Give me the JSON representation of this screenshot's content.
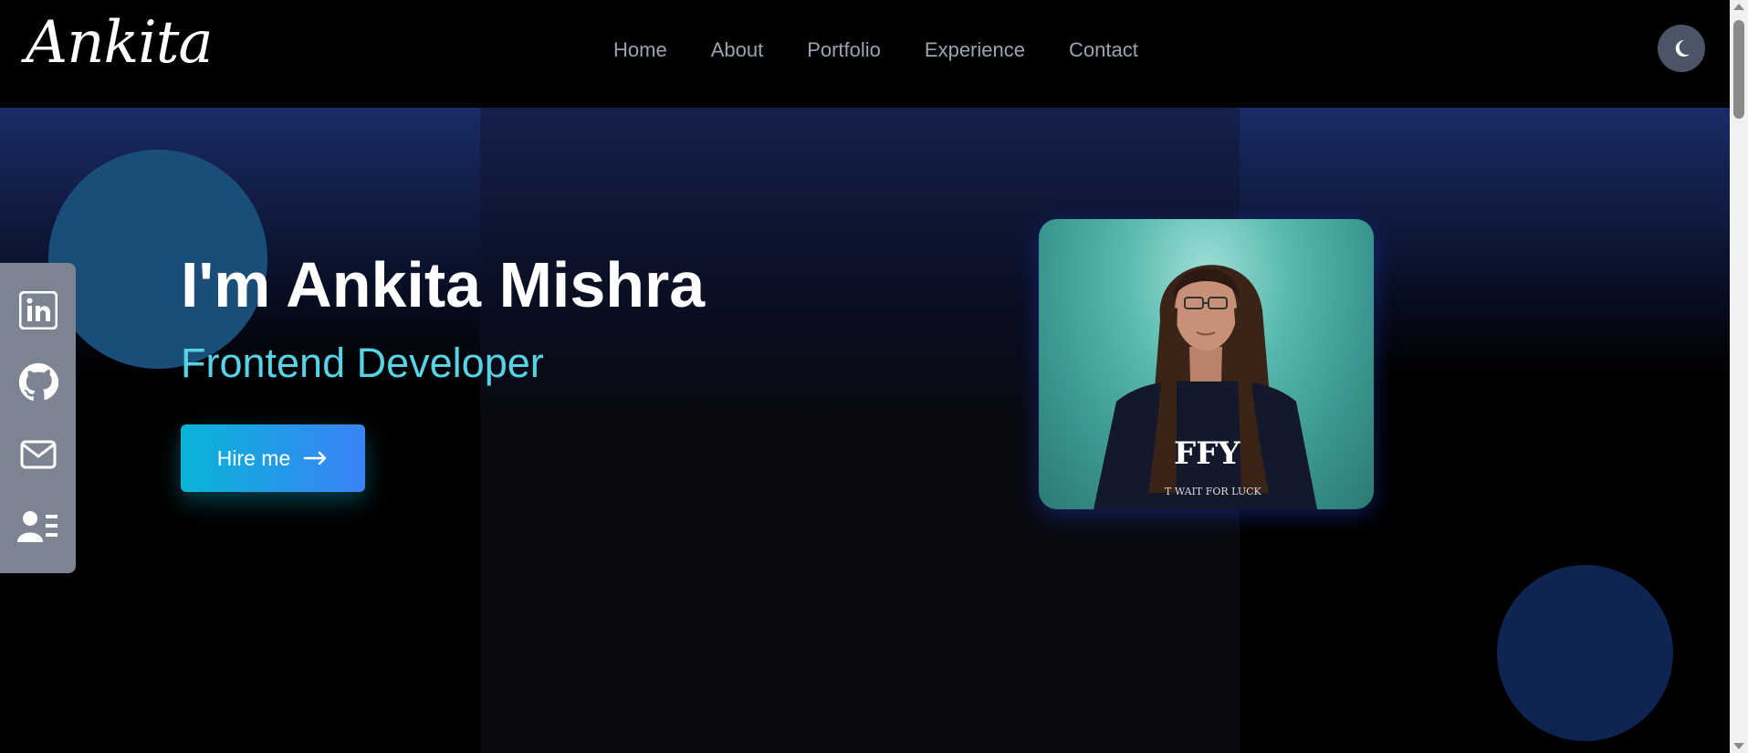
{
  "header": {
    "logo": "Ankita",
    "nav": [
      "Home",
      "About",
      "Portfolio",
      "Experience",
      "Contact"
    ],
    "theme_toggle_icon": "moon-icon"
  },
  "hero": {
    "headline": "I'm Ankita Mishra",
    "role": "Frontend Developer",
    "cta_label": "Hire me",
    "cta_icon": "arrow-right-icon",
    "photo_alt": "portrait photo",
    "photo_shirt_text": "FFY",
    "photo_shirt_subtext": "T WAIT FOR LUCK"
  },
  "social": {
    "items": [
      "linkedin-icon",
      "github-icon",
      "mail-icon",
      "resume-icon"
    ]
  },
  "colors": {
    "accent": "#57d3e6",
    "button_start": "#08b4d8",
    "button_end": "#3b82f6",
    "sidebar": "#7c8491"
  }
}
